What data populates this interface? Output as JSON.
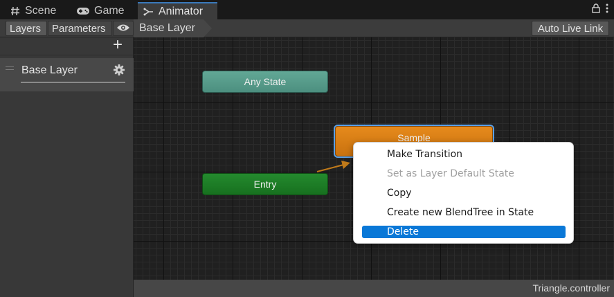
{
  "tabs": [
    {
      "label": "Scene",
      "icon": "hash-icon"
    },
    {
      "label": "Game",
      "icon": "gamepad-icon"
    },
    {
      "label": "Animator",
      "icon": "animator-icon"
    }
  ],
  "toolbar": {
    "layers_label": "Layers",
    "parameters_label": "Parameters",
    "breadcrumb": "Base Layer",
    "auto_live_link_label": "Auto Live Link"
  },
  "left_panel": {
    "add_icon": "plus-icon",
    "layer": {
      "name": "Base Layer",
      "icon": "gear-icon"
    }
  },
  "graph": {
    "nodes": {
      "any_state": "Any State",
      "entry": "Entry",
      "sample": "Sample"
    }
  },
  "context_menu": {
    "items": [
      {
        "label": "Make Transition",
        "enabled": true
      },
      {
        "label": "Set as Layer Default State",
        "enabled": false
      },
      {
        "label": "Copy",
        "enabled": true
      },
      {
        "label": "Create new BlendTree in State",
        "enabled": true
      },
      {
        "label": "Delete",
        "enabled": true,
        "highlighted": true
      }
    ]
  },
  "status": {
    "file": "Triangle.controller"
  },
  "colors": {
    "any_state": "#55998a",
    "entry": "#1e7d27",
    "sample": "#d97d14",
    "highlight": "#0a78d7",
    "accent_tab": "#3a79bb"
  }
}
